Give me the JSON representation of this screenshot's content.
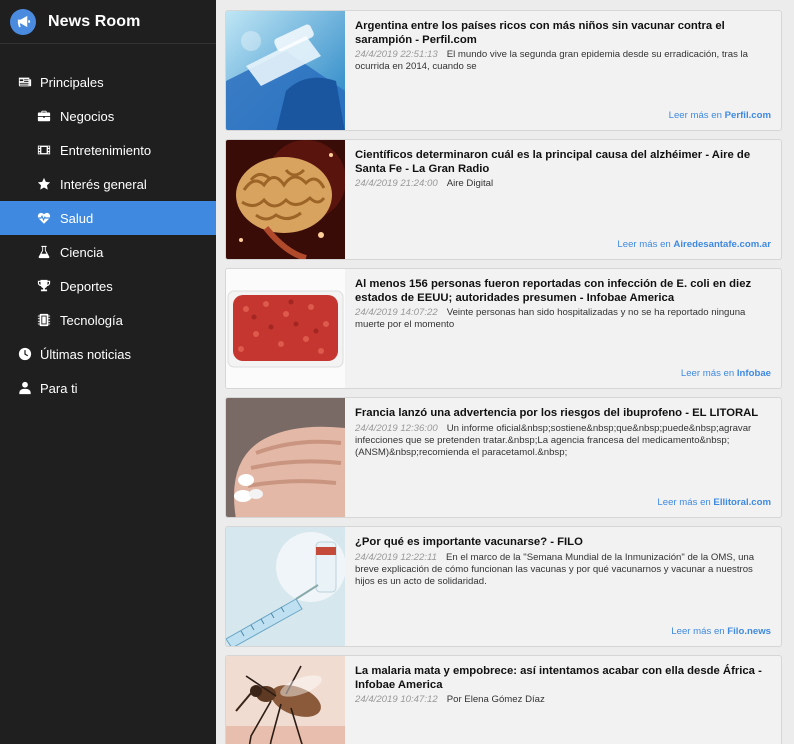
{
  "app": {
    "title": "News Room",
    "icon": "megaphone-icon",
    "accent": "#3f8ae0"
  },
  "nav": [
    {
      "key": "principales",
      "label": "Principales",
      "icon": "newspaper-icon",
      "level": "top",
      "active": false
    },
    {
      "key": "negocios",
      "label": "Negocios",
      "icon": "briefcase-icon",
      "level": "sub",
      "active": false
    },
    {
      "key": "entretenimiento",
      "label": "Entretenimiento",
      "icon": "film-icon",
      "level": "sub",
      "active": false
    },
    {
      "key": "interes-general",
      "label": "Interés general",
      "icon": "star-icon",
      "level": "sub",
      "active": false
    },
    {
      "key": "salud",
      "label": "Salud",
      "icon": "heartbeat-icon",
      "level": "sub",
      "active": true
    },
    {
      "key": "ciencia",
      "label": "Ciencia",
      "icon": "flask-icon",
      "level": "sub",
      "active": false
    },
    {
      "key": "deportes",
      "label": "Deportes",
      "icon": "trophy-icon",
      "level": "sub",
      "active": false
    },
    {
      "key": "tecnologia",
      "label": "Tecnología",
      "icon": "microchip-icon",
      "level": "sub",
      "active": false
    },
    {
      "key": "ultimas",
      "label": "Últimas noticias",
      "icon": "clock-icon",
      "level": "top",
      "active": false
    },
    {
      "key": "para-ti",
      "label": "Para ti",
      "icon": "user-icon",
      "level": "top",
      "active": false
    }
  ],
  "read_more_prefix": "Leer más en",
  "articles": [
    {
      "title": "Argentina entre los países ricos con más niños sin vacunar contra el sarampión - Perfil.com",
      "timestamp": "24/4/2019 22:51:13",
      "summary": "El mundo vive la segunda gran epidemia desde su erradicación, tras la ocurrida en 2014, cuando se",
      "source": "Perfil.com",
      "image": "vaccine-vial"
    },
    {
      "title": "Científicos determinaron cuál es la principal causa del alzhéimer - Aire de Santa Fe - La Gran Radio",
      "timestamp": "24/4/2019 21:24:00",
      "summary": "Aire Digital",
      "source": "Airedesantafe.com.ar",
      "image": "brain"
    },
    {
      "title": "Al menos 156 personas fueron reportadas con infección de E. coli en diez estados de EEUU; autoridades presumen - Infobae America",
      "timestamp": "24/4/2019 14:07:22",
      "summary": "Veinte personas han sido hospitalizadas y no se ha reportado ninguna muerte por el momento",
      "source": "Infobae",
      "image": "ground-beef"
    },
    {
      "title": "Francia lanzó una advertencia por los riesgos del ibuprofeno - EL LITORAL",
      "timestamp": "24/4/2019 12:36:00",
      "summary": "Un informe oficial&nbsp;sostiene&nbsp;que&nbsp;puede&nbsp;agravar infecciones que se pretenden tratar.&nbsp;La agencia francesa del medicamento&nbsp;(ANSM)&nbsp;recomienda el paracetamol.&nbsp;",
      "source": "Ellitoral.com",
      "image": "pills-hand"
    },
    {
      "title": "¿Por qué es importante vacunarse? - FILO",
      "timestamp": "24/4/2019 12:22:11",
      "summary": "En el marco de la \"Semana Mundial de la Inmunización\" de la OMS, una breve explicación de cómo funcionan las vacunas y por qué vacunarnos y vacunar a nuestros hijos es un acto de solidaridad.",
      "source": "Filo.news",
      "image": "syringe"
    },
    {
      "title": "La malaria mata y empobrece: así intentamos acabar con ella desde África - Infobae America",
      "timestamp": "24/4/2019 10:47:12",
      "summary": "Por Elena Gómez Díaz",
      "source": "",
      "image": "mosquito"
    }
  ]
}
